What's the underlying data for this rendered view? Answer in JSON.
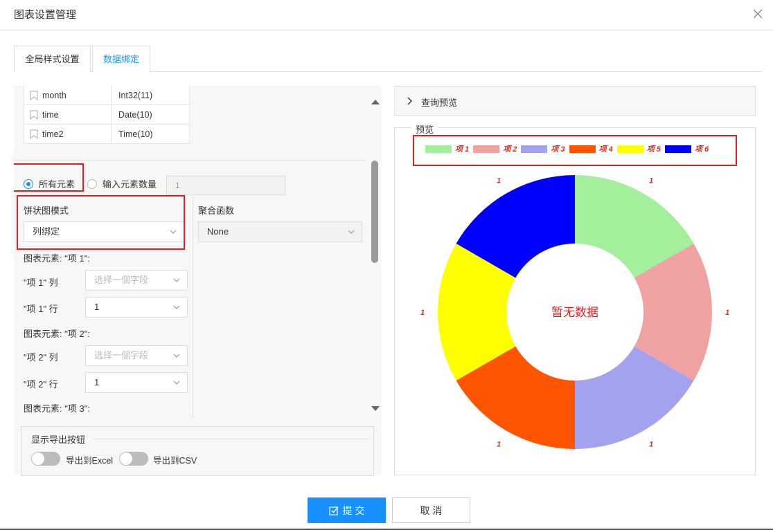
{
  "dialog": {
    "title": "图表设置管理"
  },
  "tabs": [
    {
      "label": "全局样式设置"
    },
    {
      "label": "数据绑定"
    }
  ],
  "fields": [
    {
      "name": "month",
      "type": "Int32(11)"
    },
    {
      "name": "time",
      "type": "Date(10)"
    },
    {
      "name": "time2",
      "type": "Time(10)"
    }
  ],
  "element_mode": {
    "all_label": "所有元素",
    "input_label": "输入元素数量",
    "count_value": "1"
  },
  "pie_mode": {
    "label": "饼状图模式",
    "value": "列绑定"
  },
  "aggregate": {
    "label": "聚合函数",
    "value": "None"
  },
  "elements": [
    {
      "heading": "图表元素: \"项 1\":",
      "col_label": "\"项 1\" 列",
      "col_placeholder": "选择一個字段",
      "row_label": "\"项 1\" 行",
      "row_value": "1"
    },
    {
      "heading": "图表元素: \"项 2\":",
      "col_label": "\"项 2\" 列",
      "col_placeholder": "选择一個字段",
      "row_label": "\"项 2\" 行",
      "row_value": "1"
    },
    {
      "heading": "图表元素: \"项 3\":"
    }
  ],
  "export": {
    "legend": "显示导出按钮",
    "excel_label": "导出到Excel",
    "csv_label": "导出到CSV"
  },
  "query_preview": {
    "label": "查询预览"
  },
  "preview": {
    "legend": "预览",
    "empty_text": "暂无数据"
  },
  "chart_data": {
    "type": "pie",
    "donut": true,
    "categories": [
      "项 1",
      "项 2",
      "项 3",
      "项 4",
      "项 5",
      "项 6"
    ],
    "values": [
      1,
      1,
      1,
      1,
      1,
      1
    ],
    "colors": [
      "#a3ef9b",
      "#f0a2a2",
      "#a2a2ef",
      "#ff5500",
      "#ffff00",
      "#0000ff"
    ],
    "data_labels": [
      "1",
      "1",
      "1",
      "1",
      "1",
      "1"
    ],
    "legend_position": "top"
  },
  "buttons": {
    "submit": "提 交",
    "cancel": "取 消"
  },
  "colors": {
    "accent": "#1890ff",
    "highlight_box": "#e02020"
  }
}
